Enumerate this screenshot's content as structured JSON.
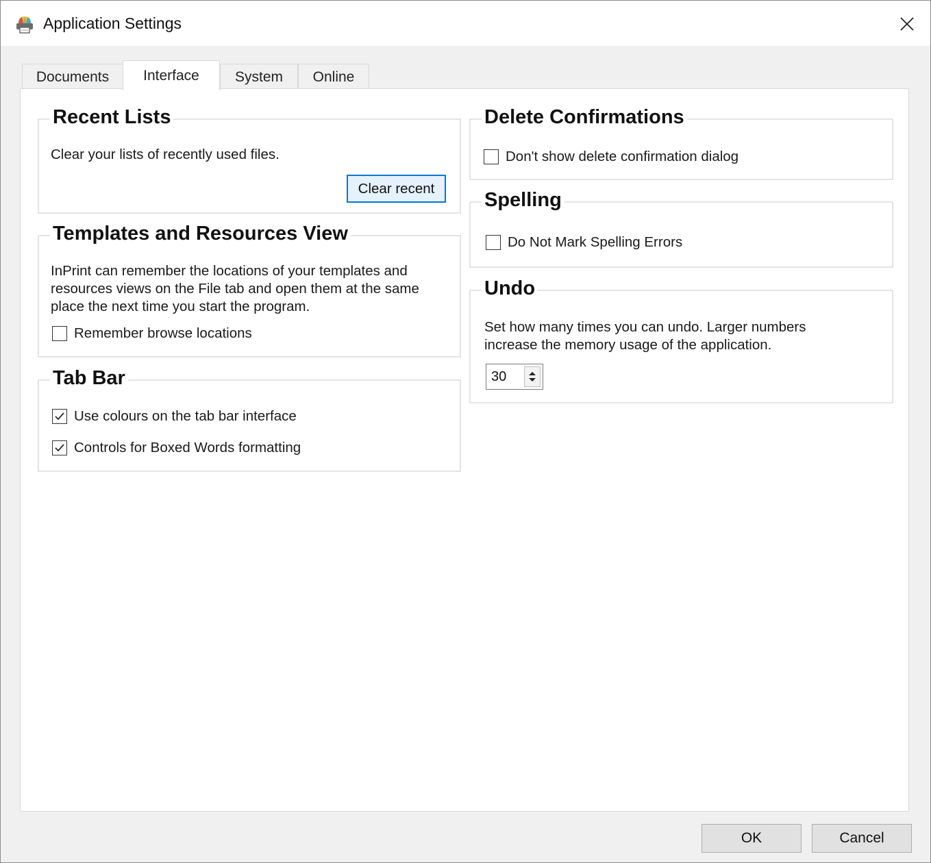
{
  "window": {
    "title": "Application Settings",
    "app_icon": "inprint-printer-icon",
    "close_icon": "close-icon"
  },
  "tabs": [
    {
      "label": "Documents",
      "active": false
    },
    {
      "label": "Interface",
      "active": true
    },
    {
      "label": "System",
      "active": false
    },
    {
      "label": "Online",
      "active": false
    }
  ],
  "recent_lists": {
    "title": "Recent Lists",
    "description": "Clear your lists of recently used files.",
    "button": "Clear recent"
  },
  "templates_view": {
    "title": "Templates and Resources View",
    "description_lines": [
      "InPrint can remember the locations of your templates and",
      "resources views on the File tab and open them at the same",
      "place the next time you start the program."
    ],
    "checkbox": {
      "label": "Remember browse locations",
      "checked": false
    }
  },
  "tab_bar": {
    "title": "Tab Bar",
    "checkboxes": [
      {
        "label": "Use colours on the tab bar interface",
        "checked": true
      },
      {
        "label": "Controls for Boxed Words formatting",
        "checked": true
      }
    ]
  },
  "delete_confirmations": {
    "title": "Delete Confirmations",
    "checkbox": {
      "label": "Don't show delete confirmation dialog",
      "checked": false
    }
  },
  "spelling": {
    "title": "Spelling",
    "checkbox": {
      "label": "Do Not Mark Spelling Errors",
      "checked": false
    }
  },
  "undo": {
    "title": "Undo",
    "description_lines": [
      "Set how many times you can undo. Larger numbers",
      "increase the memory usage of the application."
    ],
    "value": "30"
  },
  "footer": {
    "ok": "OK",
    "cancel": "Cancel"
  },
  "colors": {
    "accent": "#0078d7",
    "dialog_bg": "#f0f0f0",
    "panel_bg": "#ffffff"
  }
}
